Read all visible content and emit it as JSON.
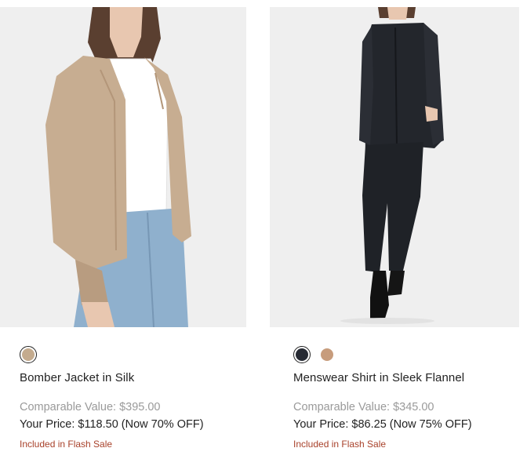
{
  "products": [
    {
      "name": "Bomber Jacket in Silk",
      "image_alt": "bomber-jacket-photo",
      "swatches": [
        {
          "color": "#c4ab8e",
          "selected": true
        }
      ],
      "comparable_value": "Comparable Value: $395.00",
      "your_price": "Your Price: $118.50 (Now 70% OFF)",
      "flash_note": "Included in Flash Sale"
    },
    {
      "name": "Menswear Shirt in Sleek Flannel",
      "image_alt": "menswear-shirt-photo",
      "swatches": [
        {
          "color": "#262a33",
          "selected": true
        },
        {
          "color": "#c79c7c",
          "selected": false
        }
      ],
      "comparable_value": "Comparable Value: $345.00",
      "your_price": "Your Price: $86.25 (Now 75% OFF)",
      "flash_note": "Included in Flash Sale"
    }
  ]
}
